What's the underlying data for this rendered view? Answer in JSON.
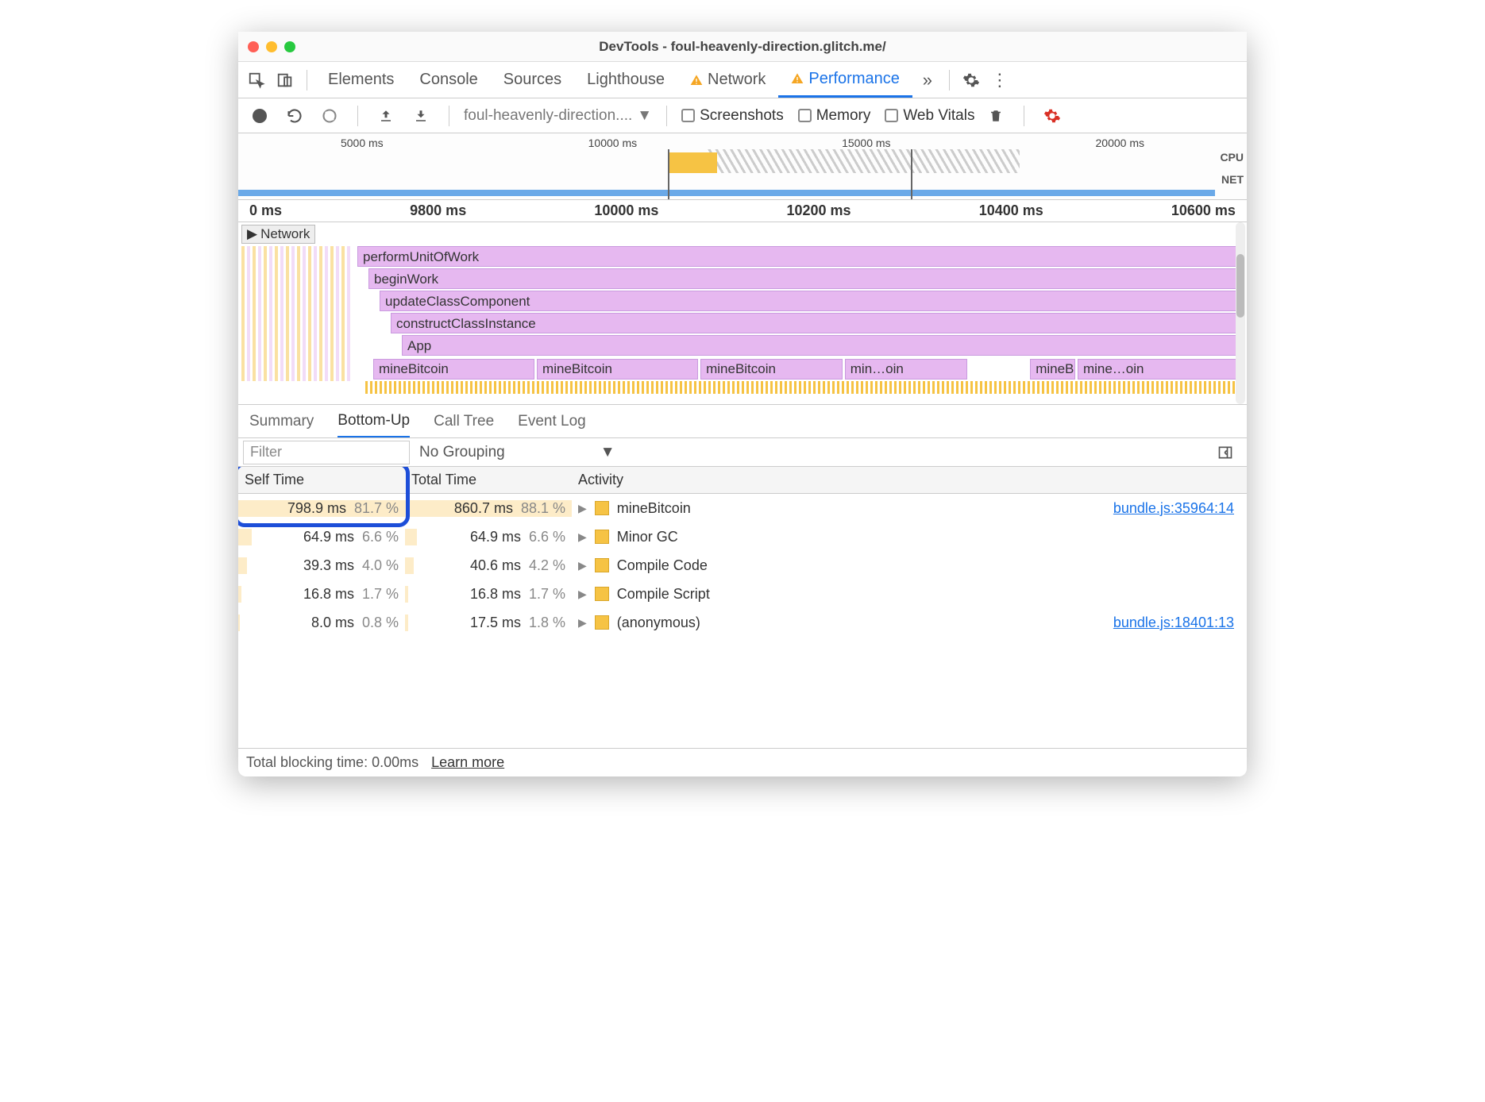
{
  "window": {
    "title": "DevTools - foul-heavenly-direction.glitch.me/"
  },
  "tabs": {
    "items": [
      "Elements",
      "Console",
      "Sources",
      "Lighthouse",
      "Network",
      "Performance"
    ],
    "warning_on": [
      "Network",
      "Performance"
    ],
    "active": "Performance"
  },
  "action": {
    "profile_name": "foul-heavenly-direction....",
    "checkboxes": [
      "Screenshots",
      "Memory",
      "Web Vitals"
    ]
  },
  "overview": {
    "ticks": [
      "5000 ms",
      "10000 ms",
      "15000 ms",
      "20000 ms"
    ],
    "labels": [
      "CPU",
      "NET"
    ]
  },
  "zoom_ruler": [
    "0 ms",
    "9800 ms",
    "10000 ms",
    "10200 ms",
    "10400 ms",
    "10600 ms"
  ],
  "flame": {
    "network_label": "Network",
    "stack": [
      "performUnitOfWork",
      "beginWork",
      "updateClassComponent",
      "constructClassInstance",
      "App"
    ],
    "mine": [
      "mineBitcoin",
      "mineBitcoin",
      "mineBitcoin",
      "min…oin",
      "mineBitcoin",
      "mine…oin"
    ]
  },
  "subtabs": {
    "items": [
      "Summary",
      "Bottom-Up",
      "Call Tree",
      "Event Log"
    ],
    "active": "Bottom-Up"
  },
  "filter": {
    "placeholder": "Filter",
    "grouping": "No Grouping"
  },
  "table": {
    "headers": {
      "self": "Self Time",
      "total": "Total Time",
      "activity": "Activity"
    },
    "rows": [
      {
        "self_ms": "798.9 ms",
        "self_pct": "81.7 %",
        "self_bar": 100,
        "total_ms": "860.7 ms",
        "total_pct": "88.1 %",
        "total_bar": 100,
        "activity": "mineBitcoin",
        "source": "bundle.js:35964:14"
      },
      {
        "self_ms": "64.9 ms",
        "self_pct": "6.6 %",
        "self_bar": 8,
        "total_ms": "64.9 ms",
        "total_pct": "6.6 %",
        "total_bar": 7,
        "activity": "Minor GC",
        "source": ""
      },
      {
        "self_ms": "39.3 ms",
        "self_pct": "4.0 %",
        "self_bar": 5,
        "total_ms": "40.6 ms",
        "total_pct": "4.2 %",
        "total_bar": 5,
        "activity": "Compile Code",
        "source": ""
      },
      {
        "self_ms": "16.8 ms",
        "self_pct": "1.7 %",
        "self_bar": 2,
        "total_ms": "16.8 ms",
        "total_pct": "1.7 %",
        "total_bar": 2,
        "activity": "Compile Script",
        "source": ""
      },
      {
        "self_ms": "8.0 ms",
        "self_pct": "0.8 %",
        "self_bar": 1,
        "total_ms": "17.5 ms",
        "total_pct": "1.8 %",
        "total_bar": 2,
        "activity": "(anonymous)",
        "source": "bundle.js:18401:13"
      }
    ]
  },
  "status": {
    "blocking": "Total blocking time: 0.00ms",
    "learn": "Learn more"
  }
}
